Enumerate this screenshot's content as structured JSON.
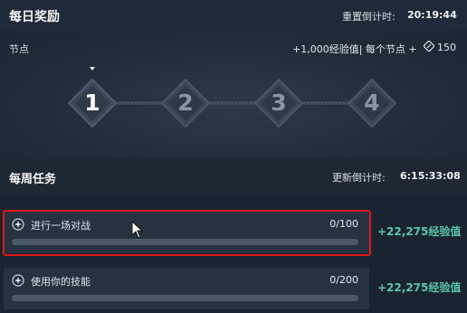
{
  "daily": {
    "title": "每日奖励",
    "reset_label": "重置倒计时:",
    "reset_time": "20:19:44",
    "nodes_label": "节点",
    "nodes_reward": "+1,000经验值| 每个节点 +",
    "token_count": "150",
    "token_icon": "token-icon",
    "nodes": [
      {
        "label": "1",
        "active": true
      },
      {
        "label": "2",
        "active": false
      },
      {
        "label": "3",
        "active": false
      },
      {
        "label": "4",
        "active": false
      }
    ]
  },
  "weekly": {
    "title": "每周任务",
    "countdown_label": "更新倒计时:",
    "countdown_time": "6:15:33:08",
    "tasks": [
      {
        "name": "进行一场对战",
        "progress_text": "0/100",
        "current": 0,
        "total": 100,
        "reward": "+22,275经验值",
        "icon": "star-badge-icon"
      },
      {
        "name": "使用你的技能",
        "progress_text": "0/200",
        "current": 0,
        "total": 200,
        "reward": "+22,275经验值",
        "icon": "star-badge-icon"
      }
    ]
  },
  "colors": {
    "accent_reward": "#5cc6a8",
    "highlight": "#e01818",
    "background": "#1a2430"
  }
}
